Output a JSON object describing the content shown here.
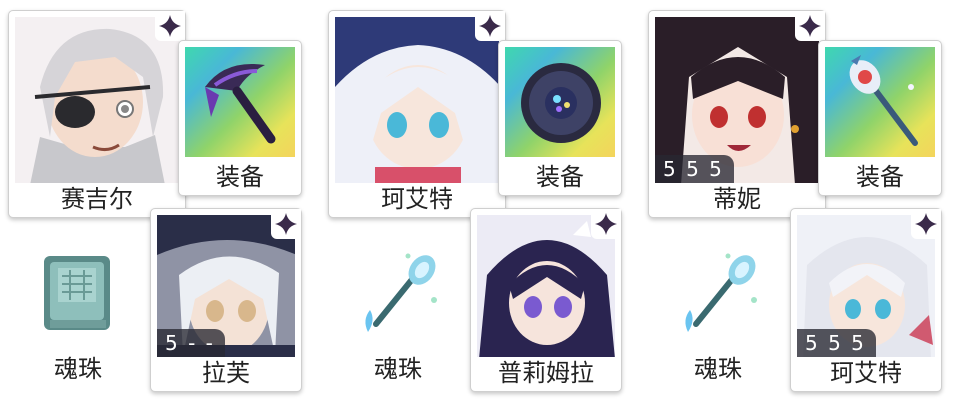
{
  "colors": {
    "badge_star": "#3a2a4a",
    "card_border": "#cfcfcf",
    "star_bar": "#2a2a36"
  },
  "groups": [
    {
      "hero": {
        "name": "赛吉尔",
        "stars": ""
      },
      "equip": {
        "label": "装备",
        "icon": "dark-scythe-icon"
      },
      "support": {
        "name": "拉芙",
        "stars": "5 - -"
      },
      "loot": {
        "label": "魂珠",
        "icon": "stone-tablet-icon"
      }
    },
    {
      "hero": {
        "name": "珂艾特",
        "stars": ""
      },
      "equip": {
        "label": "装备",
        "icon": "dark-orb-icon"
      },
      "support": {
        "name": "普莉姆拉",
        "stars": ""
      },
      "loot": {
        "label": "魂珠",
        "icon": "crystal-staff-icon"
      }
    },
    {
      "hero": {
        "name": "蒂妮",
        "stars": "5 5 5"
      },
      "equip": {
        "label": "装备",
        "icon": "crystal-staff-icon"
      },
      "support": {
        "name": "珂艾特",
        "stars": "5 5 5"
      },
      "loot": {
        "label": "魂珠",
        "icon": "crystal-staff-icon"
      }
    }
  ]
}
